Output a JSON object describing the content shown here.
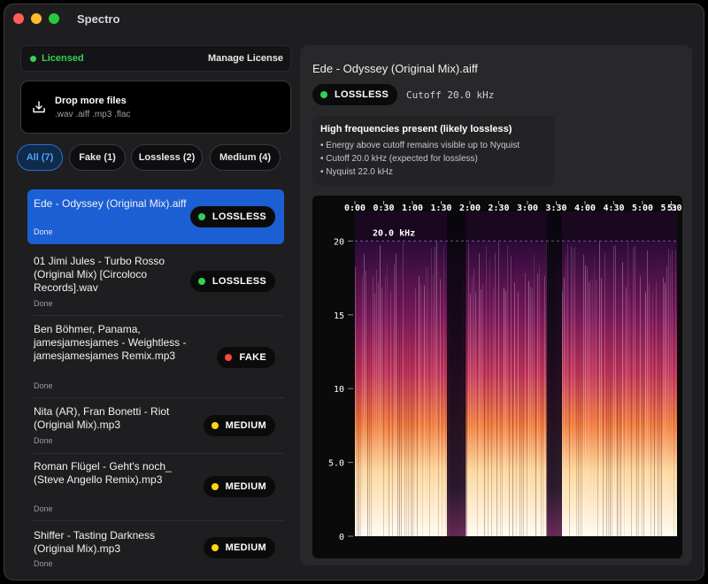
{
  "app": {
    "title": "Spectro"
  },
  "license": {
    "status": "Licensed",
    "manage_label": "Manage License"
  },
  "dropzone": {
    "icon": "download-tray-icon",
    "title": "Drop more files",
    "formats": ".wav .aiff .mp3 .flac"
  },
  "filters": [
    {
      "label": "All (7)",
      "active": true
    },
    {
      "label": "Fake (1)",
      "active": false
    },
    {
      "label": "Lossless (2)",
      "active": false
    },
    {
      "label": "Medium (4)",
      "active": false
    }
  ],
  "files": [
    {
      "name": "Ede - Odyssey (Original Mix).aiff",
      "status": "Done",
      "verdict": "LOSSLESS",
      "selected": true
    },
    {
      "name": "01 Jimi Jules - Turbo Rosso (Original Mix) [Circoloco Records].wav",
      "status": "Done",
      "verdict": "LOSSLESS",
      "selected": false
    },
    {
      "name": "Ben Böhmer, Panama, jamesjamesjames - Weightless - jamesjamesjames Remix.mp3",
      "status": "Done",
      "verdict": "FAKE",
      "selected": false
    },
    {
      "name": "Nita (AR), Fran Bonetti - Riot (Original Mix).mp3",
      "status": "Done",
      "verdict": "MEDIUM",
      "selected": false
    },
    {
      "name": "Roman Flügel - Geht's noch_ (Steve Angello Remix).mp3",
      "status": "Done",
      "verdict": "MEDIUM",
      "selected": false
    },
    {
      "name": "Shiffer - Tasting Darkness (Original Mix).mp3",
      "status": "Done",
      "verdict": "MEDIUM",
      "selected": false
    }
  ],
  "verdict_colors": {
    "LOSSLESS": "#30d158",
    "FAKE": "#ff453a",
    "MEDIUM": "#ffd60a"
  },
  "detail": {
    "title": "Ede - Odyssey (Original Mix).aiff",
    "verdict": "LOSSLESS",
    "cutoff": "Cutoff 20.0 kHz",
    "analysis": {
      "heading": "High frequencies present (likely lossless)",
      "lines": [
        "• Energy above cutoff remains visible up to Nyquist",
        "• Cutoff 20.0 kHz (expected for lossless)",
        "• Nyquist 22.0 kHz"
      ]
    }
  },
  "spectrogram": {
    "time_labels": [
      "0:00",
      "0:30",
      "1:00",
      "1:30",
      "2:00",
      "2:30",
      "3:00",
      "3:30",
      "4:00",
      "4:30",
      "5:00",
      "5:30"
    ],
    "time_end_label": "5:",
    "freq_labels": [
      "20",
      "15",
      "10",
      "5.0",
      "0"
    ],
    "freq_values_khz": [
      20,
      15,
      10,
      5,
      0
    ],
    "max_freq_khz": 22,
    "cutoff_khz": 20,
    "cutoff_label": "20.0 kHz",
    "duration_min": 5.6,
    "quiet_sections_min": [
      [
        1.6,
        1.93
      ],
      [
        3.33,
        3.6
      ]
    ]
  }
}
